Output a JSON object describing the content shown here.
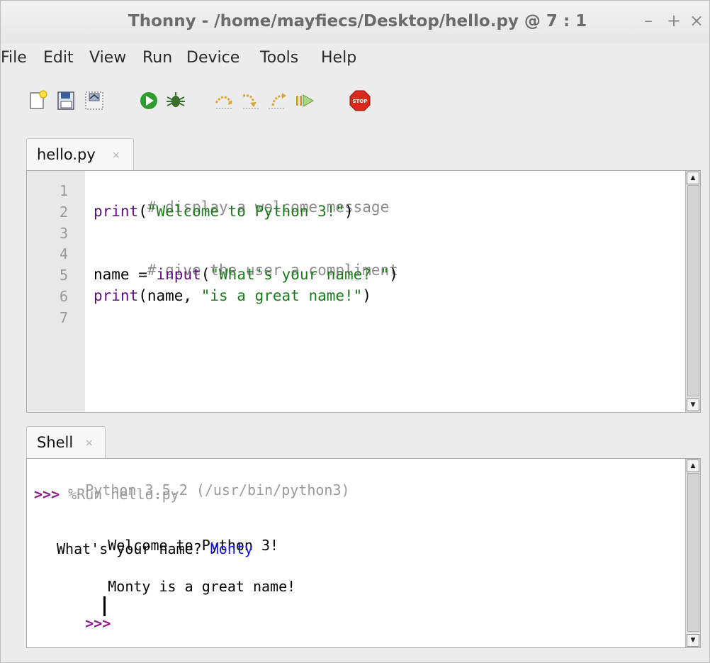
{
  "window": {
    "title": "Thonny - /home/mayfiecs/Desktop/hello.py @ 7 : 1",
    "controls": {
      "minimize": "–",
      "maximize": "+",
      "close": "×"
    }
  },
  "menu": [
    "File",
    "Edit",
    "View",
    "Run",
    "Device",
    "Tools",
    "Help"
  ],
  "toolbar": [
    {
      "name": "new-file-icon"
    },
    {
      "name": "open-file-icon"
    },
    {
      "name": "save-file-icon"
    },
    {
      "name": "run-icon"
    },
    {
      "name": "debug-icon"
    },
    {
      "name": "step-over-icon"
    },
    {
      "name": "step-into-icon"
    },
    {
      "name": "step-out-icon"
    },
    {
      "name": "resume-icon"
    },
    {
      "name": "stop-icon"
    }
  ],
  "stop_label": "STOP",
  "editor": {
    "tab_label": "hello.py",
    "tab_close": "×",
    "line_numbers": [
      "1",
      "2",
      "3",
      "4",
      "5",
      "6",
      "7"
    ],
    "code": {
      "l1": "# display a welcome message",
      "l2_fn": "print",
      "l2_open": "(",
      "l2_str": "\"Welcome to Python 3!\"",
      "l2_close": ")",
      "l4": "# give the user a compliment",
      "l5_var": "name = ",
      "l5_fn": "input",
      "l5_open": "(",
      "l5_str": "\"What's your name? \"",
      "l5_close": ")",
      "l6_fn": "print",
      "l6_args": "(name, ",
      "l6_str": "\"is a great name!\"",
      "l6_close": ")"
    }
  },
  "shell": {
    "tab_label": "Shell",
    "tab_close": "×",
    "python_version": "Python 3.5.2 (/usr/bin/python3)",
    "prompt": ">>>",
    "run_cmd": "%Run hello.py",
    "out1": "Welcome to Python 3!",
    "out2_prefix": "What's your name? ",
    "out2_input": "Monty",
    "out3": "Monty is a great name!"
  },
  "colors": {
    "comment": "#8c8c8c",
    "function": "#5a0f7a",
    "string": "#1c7a1c",
    "prompt": "#8b1a8b",
    "user_input": "#1818e6"
  }
}
